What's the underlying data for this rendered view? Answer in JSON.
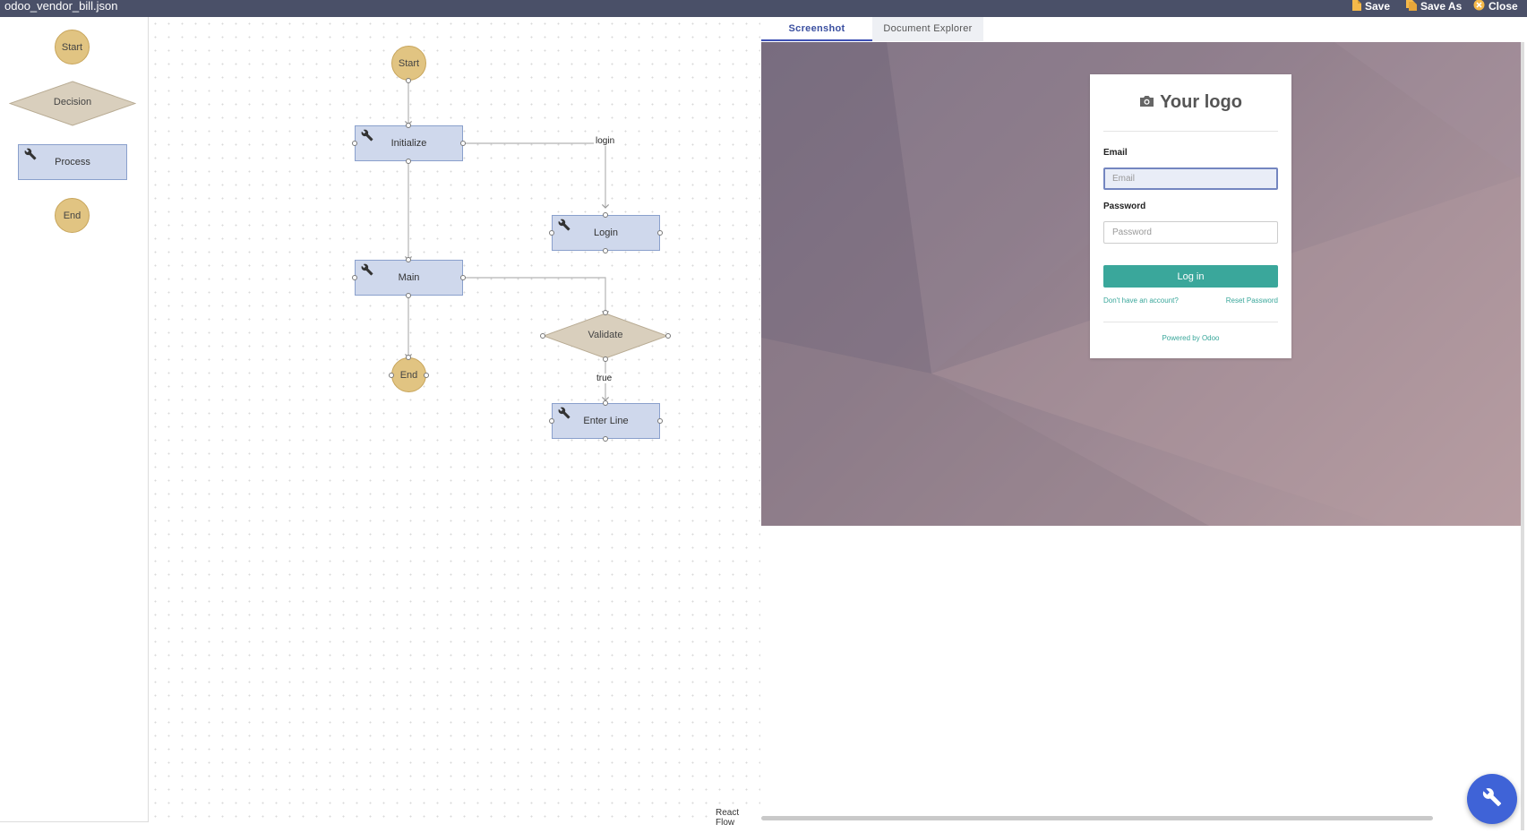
{
  "topbar": {
    "file_name": "odoo_vendor_bill.json",
    "save_label": "Save",
    "save_as_label": "Save As",
    "close_label": "Close"
  },
  "palette": {
    "start_label": "Start",
    "decision_label": "Decision",
    "process_label": "Process",
    "end_label": "End"
  },
  "flow": {
    "start_label": "Start",
    "initialize_label": "Initialize",
    "login_label": "Login",
    "main_label": "Main",
    "validate_label": "Validate",
    "end_label": "End",
    "enter_line_label": "Enter Line",
    "edge_login_label": "login",
    "edge_true_label": "true",
    "attribution": "React Flow"
  },
  "tabs": {
    "screenshot_label": "Screenshot",
    "explorer_label": "Document Explorer",
    "active": "Screenshot"
  },
  "login_screen": {
    "logo_text": "Your logo",
    "email_label": "Email",
    "email_placeholder": "Email",
    "password_label": "Password",
    "password_placeholder": "Password",
    "login_button": "Log in",
    "no_account_link": "Don't have an account?",
    "reset_password_link": "Reset Password",
    "powered_by": "Powered by Odoo"
  },
  "colors": {
    "topbar": "#4a5068",
    "terminal_node": "#e1c482",
    "process_node": "#cfd8ec",
    "decision_node": "#d9cfbd",
    "login_button": "#3aa79b",
    "fab": "#3f63d7",
    "active_tab": "#3f51b5"
  },
  "icons": {
    "save": "file-icon",
    "save_as": "copy-file-icon",
    "close": "close-circle-icon",
    "process": "wrench-icon",
    "fab": "wrench-icon",
    "logo": "camera-icon"
  }
}
